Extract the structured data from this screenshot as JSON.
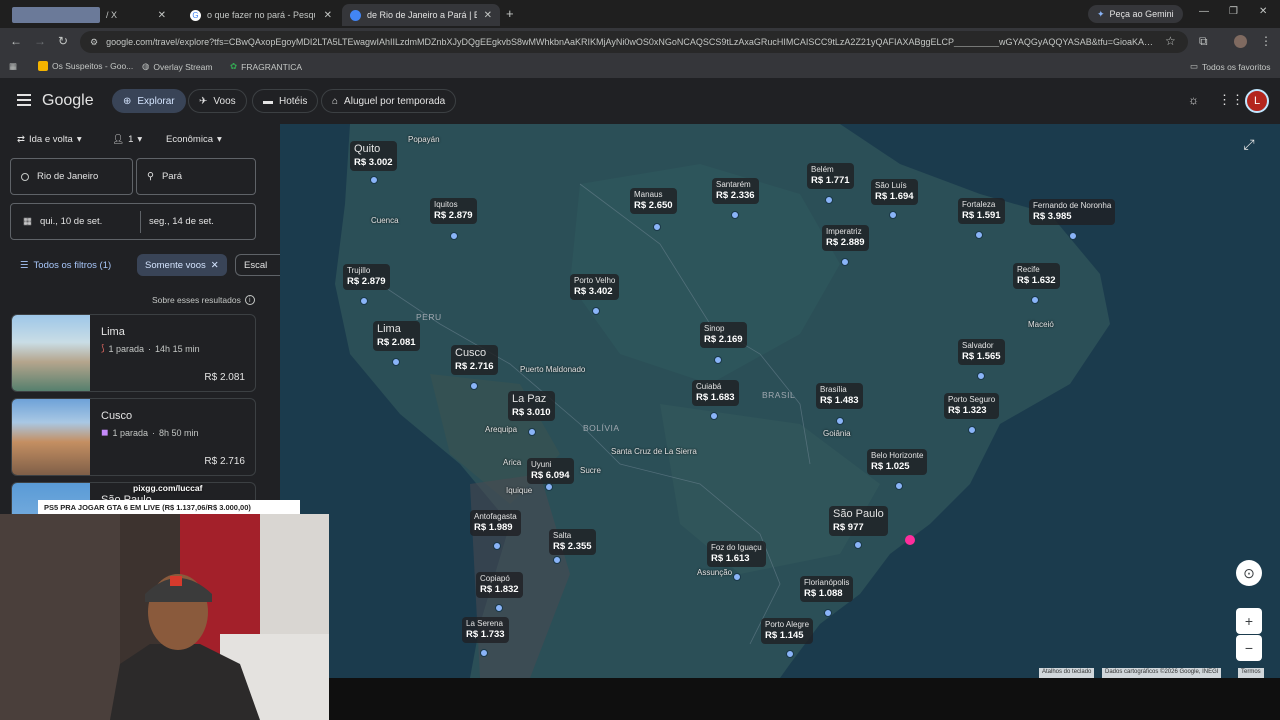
{
  "browser": {
    "tabs": [
      {
        "title": "/ X",
        "active": false
      },
      {
        "title": "o que fazer no pará - Pesquisa",
        "active": false
      },
      {
        "title": "de Rio de Janeiro a Pará | Explo",
        "active": true
      }
    ],
    "new_tab": "+",
    "gemini": "Peça ao Gemini",
    "url": "google.com/travel/explore?tfs=CBwQAxopEgoyMDI2LTA5LTEwagwIAhIILzdmMDZnbXJyDQgEEgkvbS8wMWhkbnAaKRIKMjAyNi0wOS0xNGoNCAQSCS9tLzAxaGRucHIMCAISCC9tLzA2Z21yQAFIAXABggELCP_________wGYAQGyAQQYASAB&tfu=GioaKAoSCe...",
    "bookmarks": [
      "Os Suspeitos - Goo...",
      "Overlay Stream",
      "FRAGRANTICA"
    ],
    "all_bookmarks": "Todos os favoritos"
  },
  "app": {
    "logo": "Google",
    "nav": [
      "Explorar",
      "Voos",
      "Hotéis",
      "Aluguel por temporada"
    ],
    "avatar": "L"
  },
  "search": {
    "trip_type": "Ida e volta",
    "passengers": "1",
    "cabin": "Econômica",
    "origin": "Rio de Janeiro",
    "destination": "Pará",
    "depart": "qui., 10 de set.",
    "return": "seg., 14 de set.",
    "all_filters": "Todos os filtros (1)",
    "chip_nonstop": "Somente voos",
    "chip_stops": "Escal",
    "about": "Sobre esses resultados"
  },
  "results": [
    {
      "city": "Lima",
      "stops": "1 parada",
      "duration": "14h 15 min",
      "price": "R$ 2.081"
    },
    {
      "city": "Cusco",
      "stops": "1 parada",
      "duration": "8h 50 min",
      "price": "R$ 2.716"
    },
    {
      "city": "São Paulo"
    }
  ],
  "map": {
    "countries": [
      "PERU",
      "BOLÍVIA",
      "BRASIL"
    ],
    "labels": [
      {
        "city": "Quito",
        "price": "R$ 3.002",
        "big": true
      },
      {
        "city": "Iquitos",
        "price": "R$ 2.879"
      },
      {
        "city": "Manaus",
        "price": "R$ 2.650"
      },
      {
        "city": "Santarém",
        "price": "R$ 2.336"
      },
      {
        "city": "Belém",
        "price": "R$ 1.771"
      },
      {
        "city": "São Luís",
        "price": "R$ 1.694"
      },
      {
        "city": "Fortaleza",
        "price": "R$ 1.591"
      },
      {
        "city": "Fernando de Noronha",
        "price": "R$ 3.985"
      },
      {
        "city": "Imperatriz",
        "price": "R$ 2.889"
      },
      {
        "city": "Trujillo",
        "price": "R$ 2.879"
      },
      {
        "city": "Porto Velho",
        "price": "R$ 3.402"
      },
      {
        "city": "Recife",
        "price": "R$ 1.632"
      },
      {
        "city": "Lima",
        "price": "R$ 2.081",
        "big": true
      },
      {
        "city": "Cusco",
        "price": "R$ 2.716",
        "big": true
      },
      {
        "city": "Sinop",
        "price": "R$ 2.169"
      },
      {
        "city": "Salvador",
        "price": "R$ 1.565"
      },
      {
        "city": "La Paz",
        "price": "R$ 3.010",
        "big": true
      },
      {
        "city": "Cuiabá",
        "price": "R$ 1.683"
      },
      {
        "city": "Brasília",
        "price": "R$ 1.483"
      },
      {
        "city": "Porto Seguro",
        "price": "R$ 1.323"
      },
      {
        "city": "Uyuni",
        "price": "R$ 6.094"
      },
      {
        "city": "Belo Horizonte",
        "price": "R$ 1.025"
      },
      {
        "city": "Antofagasta",
        "price": "R$ 1.989"
      },
      {
        "city": "São Paulo",
        "price": "R$ 977",
        "big": true
      },
      {
        "city": "Salta",
        "price": "R$ 2.355"
      },
      {
        "city": "Foz do Iguaçu",
        "price": "R$ 1.613"
      },
      {
        "city": "Copiapó",
        "price": "R$ 1.832"
      },
      {
        "city": "Florianópolis",
        "price": "R$ 1.088"
      },
      {
        "city": "La Serena",
        "price": "R$ 1.733"
      },
      {
        "city": "Porto Alegre",
        "price": "R$ 1.145"
      }
    ],
    "place_names": [
      "Popayán",
      "Cuenca",
      "Puerto Maldonado",
      "Arequipa",
      "Santa Cruz de La Sierra",
      "Arica",
      "Sucre",
      "Iquique",
      "Goiânia",
      "Maceió",
      "Assunção"
    ],
    "attribution": [
      "Atalhos do teclado",
      "Dados cartográficos ©2026 Google, INEGI",
      "Termos"
    ]
  },
  "stream": {
    "pix": "pixgg.com/luccaf",
    "goal": "PS5 PRA JOGAR GTA 6 EM LIVE (R$ 1.137,06/R$ 3.000,00)"
  }
}
